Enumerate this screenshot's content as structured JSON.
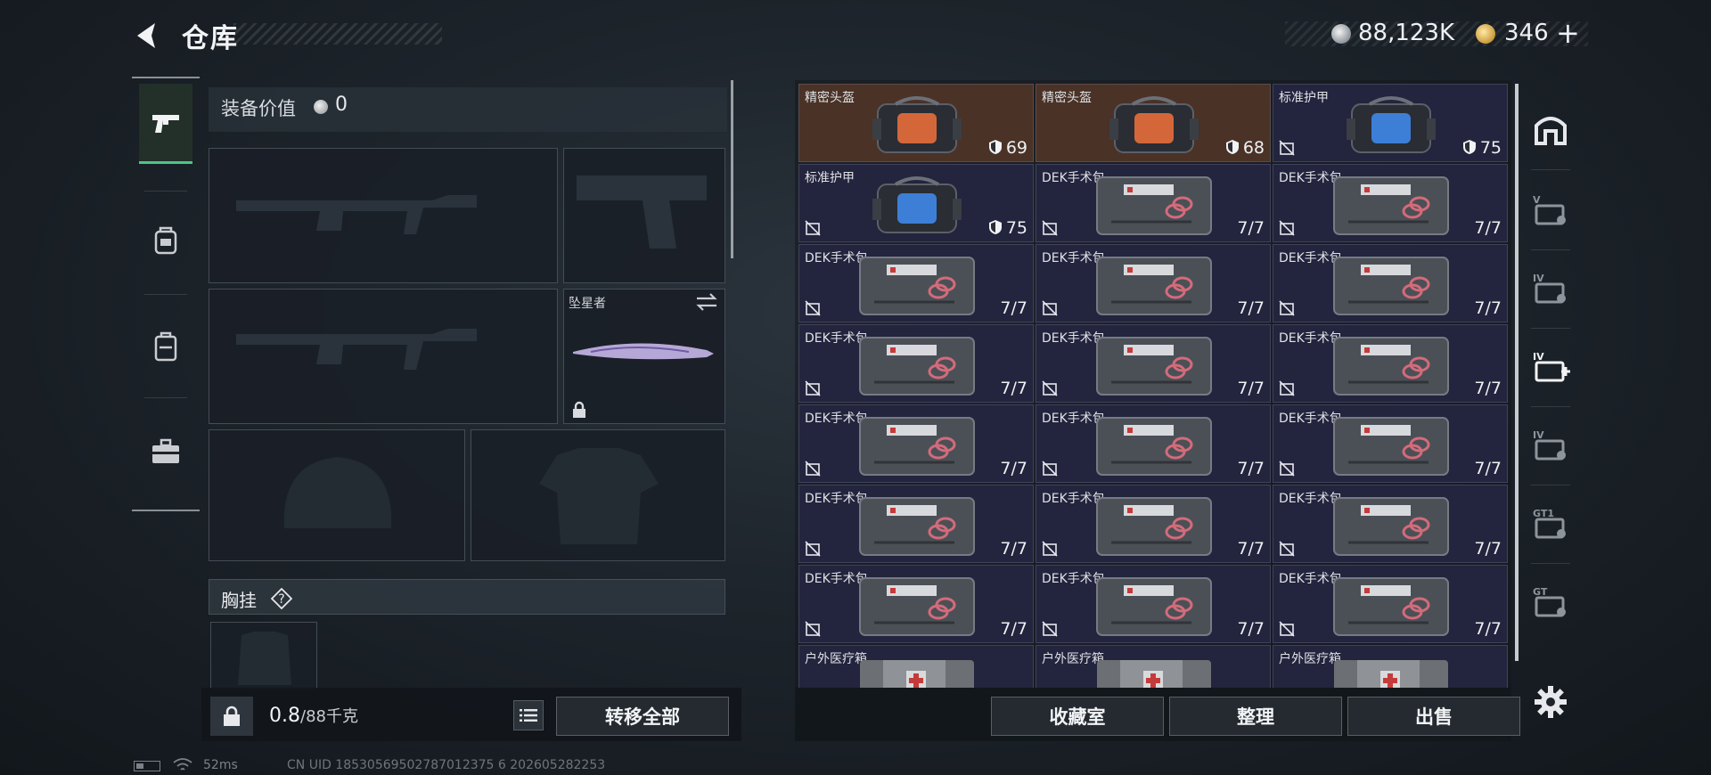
{
  "header": {
    "title": "仓库",
    "silver_amount": "88,123K",
    "gold_amount": "346"
  },
  "left_nav": {
    "items": [
      {
        "id": "weapons",
        "icon": "pistol-icon",
        "active": true
      },
      {
        "id": "gear",
        "icon": "backpack-armor-icon",
        "active": false
      },
      {
        "id": "backpack",
        "icon": "backpack-icon",
        "active": false
      },
      {
        "id": "case",
        "icon": "briefcase-icon",
        "active": false
      }
    ]
  },
  "equipment": {
    "value_label": "装备价值",
    "value": "0",
    "melee_name": "坠星者",
    "chest_rig_label": "胸挂",
    "help_symbol": "?",
    "weight_current": "0.8",
    "weight_rest": "/88千克",
    "transfer_all_label": "转移全部"
  },
  "storage": {
    "items": [
      {
        "name": "精密头盔",
        "kind": "helmet-bag",
        "value": "69",
        "shield": true,
        "highlight": true
      },
      {
        "name": "精密头盔",
        "kind": "helmet-bag",
        "value": "68",
        "shield": true,
        "highlight": true
      },
      {
        "name": "标准护甲",
        "kind": "armor-bag",
        "value": "75",
        "shield": true,
        "noicon": true
      },
      {
        "name": "标准护甲",
        "kind": "armor-bag",
        "value": "75",
        "shield": true,
        "noicon": true
      },
      {
        "name": "DEK手术包",
        "kind": "firstaid",
        "value": "7/7",
        "noicon": true
      },
      {
        "name": "DEK手术包",
        "kind": "firstaid",
        "value": "7/7",
        "noicon": true
      },
      {
        "name": "DEK手术包",
        "kind": "firstaid",
        "value": "7/7",
        "noicon": true
      },
      {
        "name": "DEK手术包",
        "kind": "firstaid",
        "value": "7/7",
        "noicon": true
      },
      {
        "name": "DEK手术包",
        "kind": "firstaid",
        "value": "7/7",
        "noicon": true
      },
      {
        "name": "DEK手术包",
        "kind": "firstaid",
        "value": "7/7",
        "noicon": true
      },
      {
        "name": "DEK手术包",
        "kind": "firstaid",
        "value": "7/7",
        "noicon": true
      },
      {
        "name": "DEK手术包",
        "kind": "firstaid",
        "value": "7/7",
        "noicon": true
      },
      {
        "name": "DEK手术包",
        "kind": "firstaid",
        "value": "7/7",
        "noicon": true
      },
      {
        "name": "DEK手术包",
        "kind": "firstaid",
        "value": "7/7",
        "noicon": true
      },
      {
        "name": "DEK手术包",
        "kind": "firstaid",
        "value": "7/7",
        "noicon": true
      },
      {
        "name": "DEK手术包",
        "kind": "firstaid",
        "value": "7/7",
        "noicon": true
      },
      {
        "name": "DEK手术包",
        "kind": "firstaid",
        "value": "7/7",
        "noicon": true
      },
      {
        "name": "DEK手术包",
        "kind": "firstaid",
        "value": "7/7",
        "noicon": true
      },
      {
        "name": "DEK手术包",
        "kind": "firstaid",
        "value": "7/7",
        "noicon": true
      },
      {
        "name": "DEK手术包",
        "kind": "firstaid",
        "value": "7/7",
        "noicon": true
      },
      {
        "name": "DEK手术包",
        "kind": "firstaid",
        "value": "7/7",
        "noicon": true
      },
      {
        "name": "户外医疗箱",
        "kind": "medkit",
        "value": ""
      },
      {
        "name": "户外医疗箱",
        "kind": "medkit",
        "value": ""
      },
      {
        "name": "户外医疗箱",
        "kind": "medkit",
        "value": ""
      }
    ],
    "actions": {
      "vault": "收藏室",
      "sort": "整理",
      "sell": "出售"
    }
  },
  "right_nav": {
    "items": [
      {
        "icon": "safehouse-icon",
        "label": ""
      },
      {
        "icon": "stash-v-icon",
        "label": "V"
      },
      {
        "icon": "stash-iv-icon",
        "label": "IV"
      },
      {
        "icon": "stash-iv-plus-icon",
        "label": "IV"
      },
      {
        "icon": "stash-iv-folder-icon",
        "label": "IV"
      },
      {
        "icon": "stash-gt1-icon",
        "label": "GT1"
      },
      {
        "icon": "stash-gt1-b-icon",
        "label": "GT"
      }
    ]
  },
  "status": {
    "ping": "52ms",
    "uid": "CN UID 18530569502787012375 6 202605282253"
  },
  "colors": {
    "accent_green": "#4ec48a",
    "cell_bg": "#23243d",
    "cell_highlight": "#4a3227"
  }
}
